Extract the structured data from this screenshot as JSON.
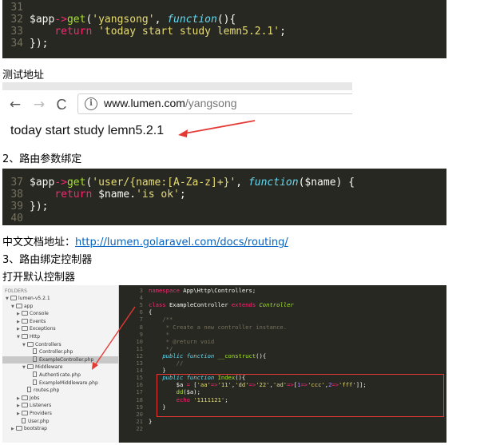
{
  "code1": {
    "lines": [
      {
        "num": "31",
        "text": ""
      },
      {
        "num": "32",
        "text": "$app->get('yangsong', function(){"
      },
      {
        "num": "33",
        "text": "    return 'today start study lemn5.2.1';"
      },
      {
        "num": "34",
        "text": "});"
      }
    ]
  },
  "heading_test_url": "测试地址",
  "browser": {
    "back_icon": "←",
    "forward_icon": "→",
    "reload_icon": "C",
    "info_icon": "i",
    "url_host": "www.lumen.com",
    "url_path": "/yangsong",
    "page_text": "today start study lemn5.2.1"
  },
  "heading_param": "2、路由参数绑定",
  "code2": {
    "lines": [
      {
        "num": "37",
        "text": "$app->get('user/{name:[A-Za-z]+}', function($name) {"
      },
      {
        "num": "38",
        "text": "    return $name.'is ok';"
      },
      {
        "num": "39",
        "text": "});"
      },
      {
        "num": "40",
        "text": ""
      }
    ]
  },
  "doc_label": "中文文档地址：",
  "doc_url": "http://lumen.golaravel.com/docs/routing/",
  "heading_controller": "3、路由绑定控制器",
  "heading_open": "打开默认控制器",
  "editor": {
    "sidebar": {
      "header": "FOLDERS",
      "items": [
        {
          "label": "lumen-v5.2.1",
          "kind": "folder",
          "depth": 0,
          "open": true
        },
        {
          "label": "app",
          "kind": "folder",
          "depth": 1,
          "open": true
        },
        {
          "label": "Console",
          "kind": "folder",
          "depth": 2,
          "open": false
        },
        {
          "label": "Events",
          "kind": "folder",
          "depth": 2,
          "open": false
        },
        {
          "label": "Exceptions",
          "kind": "folder",
          "depth": 2,
          "open": false
        },
        {
          "label": "Http",
          "kind": "folder",
          "depth": 2,
          "open": true
        },
        {
          "label": "Controllers",
          "kind": "folder",
          "depth": 3,
          "open": true
        },
        {
          "label": "Controller.php",
          "kind": "file",
          "depth": 4
        },
        {
          "label": "ExampleController.php",
          "kind": "file",
          "depth": 4,
          "selected": true
        },
        {
          "label": "Middleware",
          "kind": "folder",
          "depth": 3,
          "open": true
        },
        {
          "label": "Authenticate.php",
          "kind": "file",
          "depth": 4
        },
        {
          "label": "ExampleMiddleware.php",
          "kind": "file",
          "depth": 4
        },
        {
          "label": "routes.php",
          "kind": "file",
          "depth": 3
        },
        {
          "label": "Jobs",
          "kind": "folder",
          "depth": 2,
          "open": false
        },
        {
          "label": "Listeners",
          "kind": "folder",
          "depth": 2,
          "open": false
        },
        {
          "label": "Providers",
          "kind": "folder",
          "depth": 2,
          "open": false
        },
        {
          "label": "User.php",
          "kind": "file",
          "depth": 2
        },
        {
          "label": "bootstrap",
          "kind": "folder",
          "depth": 1,
          "open": false
        }
      ]
    },
    "code_lines": [
      {
        "num": "3",
        "text": "namespace App\\Http\\Controllers;"
      },
      {
        "num": "4",
        "text": ""
      },
      {
        "num": "5",
        "text": "class ExampleController extends Controller"
      },
      {
        "num": "6",
        "text": "{"
      },
      {
        "num": "7",
        "text": "    /**"
      },
      {
        "num": "8",
        "text": "     * Create a new controller instance."
      },
      {
        "num": "9",
        "text": "     *"
      },
      {
        "num": "10",
        "text": "     * @return void"
      },
      {
        "num": "11",
        "text": "     */"
      },
      {
        "num": "12",
        "text": "    public function __construct(){"
      },
      {
        "num": "13",
        "text": "        //"
      },
      {
        "num": "14",
        "text": "    }"
      },
      {
        "num": "15",
        "text": "    public function Index(){"
      },
      {
        "num": "16",
        "text": "        $a = ['aa'=>'11','dd'=>'22','ad'=>[1=>'ccc',2=>'fff']];"
      },
      {
        "num": "17",
        "text": "        dd($a);"
      },
      {
        "num": "18",
        "text": "        echo '1111121';"
      },
      {
        "num": "19",
        "text": "    }"
      },
      {
        "num": "20",
        "text": ""
      },
      {
        "num": "21",
        "text": "}"
      },
      {
        "num": "22",
        "text": ""
      }
    ]
  },
  "colors": {
    "editor_bg": "#272822",
    "line_number": "#75715e",
    "keyword_pink": "#f92672",
    "function_green": "#a6e22e",
    "string_yellow": "#e6db74",
    "storage_blue": "#66d9ef",
    "annotation_red": "#e53935",
    "link_blue": "#0563c1"
  }
}
